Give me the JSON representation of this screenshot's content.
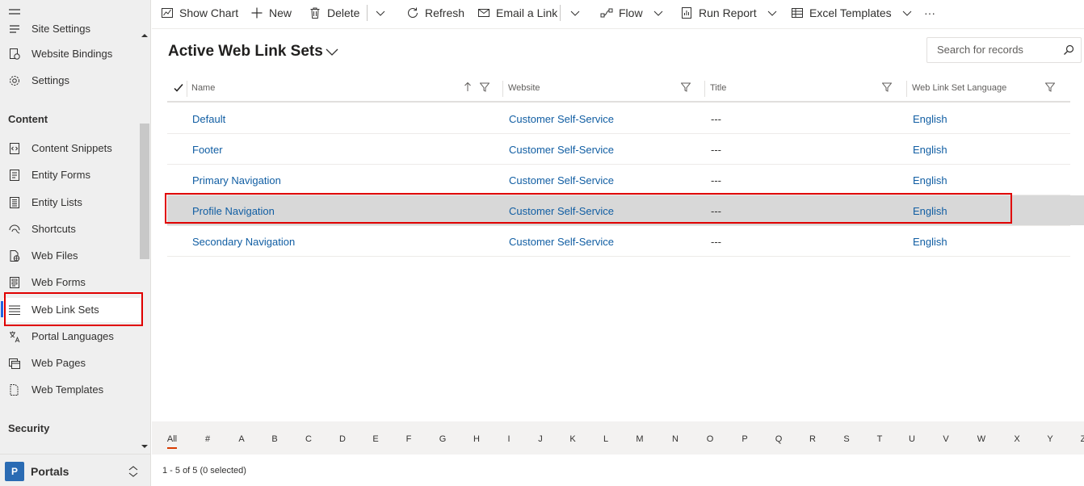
{
  "sidebar": {
    "items_top": [
      {
        "label": "Site Settings",
        "icon": "settings-list-icon"
      },
      {
        "label": "Website Bindings",
        "icon": "website-binding-icon"
      },
      {
        "label": "Settings",
        "icon": "gear-icon"
      }
    ],
    "groups": [
      {
        "title": "Content"
      },
      {
        "title": "Security"
      }
    ],
    "content_items": [
      {
        "label": "Content Snippets",
        "icon": "snippet-icon"
      },
      {
        "label": "Entity Forms",
        "icon": "form-icon"
      },
      {
        "label": "Entity Lists",
        "icon": "list-icon"
      },
      {
        "label": "Shortcuts",
        "icon": "shortcut-icon"
      },
      {
        "label": "Web Files",
        "icon": "web-file-icon"
      },
      {
        "label": "Web Forms",
        "icon": "web-form-icon"
      },
      {
        "label": "Web Link Sets",
        "icon": "link-set-icon",
        "selected": true
      },
      {
        "label": "Portal Languages",
        "icon": "language-icon"
      },
      {
        "label": "Web Pages",
        "icon": "web-page-icon"
      },
      {
        "label": "Web Templates",
        "icon": "template-icon"
      }
    ],
    "area": {
      "badge": "P",
      "label": "Portals"
    }
  },
  "commandbar": {
    "show_chart": "Show Chart",
    "new": "New",
    "delete": "Delete",
    "refresh": "Refresh",
    "email_link": "Email a Link",
    "flow": "Flow",
    "run_report": "Run Report",
    "excel_templates": "Excel Templates",
    "more": "···"
  },
  "view": {
    "title": "Active Web Link Sets"
  },
  "search": {
    "placeholder": "Search for records"
  },
  "grid": {
    "columns": [
      "Name",
      "Website",
      "Title",
      "Web Link Set Language"
    ],
    "rows": [
      {
        "name": "Default",
        "website": "Customer Self-Service",
        "title": "---",
        "language": "English"
      },
      {
        "name": "Footer",
        "website": "Customer Self-Service",
        "title": "---",
        "language": "English"
      },
      {
        "name": "Primary Navigation",
        "website": "Customer Self-Service",
        "title": "---",
        "language": "English"
      },
      {
        "name": "Profile Navigation",
        "website": "Customer Self-Service",
        "title": "---",
        "language": "English",
        "selected": true
      },
      {
        "name": "Secondary Navigation",
        "website": "Customer Self-Service",
        "title": "---",
        "language": "English"
      }
    ]
  },
  "jumpbar": {
    "letters": [
      "All",
      "#",
      "A",
      "B",
      "C",
      "D",
      "E",
      "F",
      "G",
      "H",
      "I",
      "J",
      "K",
      "L",
      "M",
      "N",
      "O",
      "P",
      "Q",
      "R",
      "S",
      "T",
      "U",
      "V",
      "W",
      "X",
      "Y",
      "Z"
    ],
    "active": "All"
  },
  "status": "1 - 5 of 5 (0 selected)",
  "colors": {
    "accent": "#2266e3",
    "link": "#115ea3",
    "highlight": "#e00000",
    "jump_active": "#d83b01",
    "badge": "#2a6bb3"
  }
}
